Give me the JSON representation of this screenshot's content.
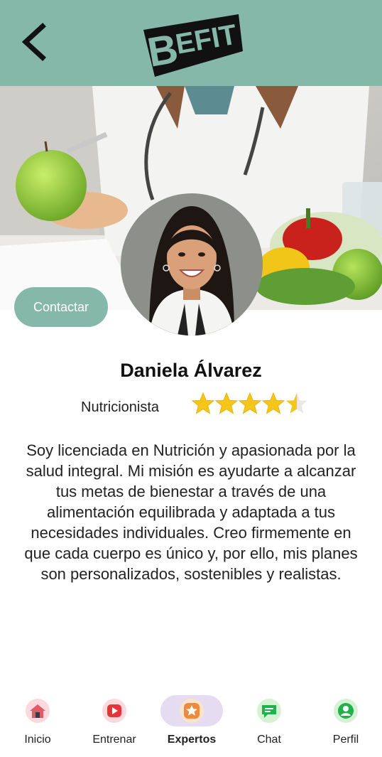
{
  "header": {
    "logo_text": "BEFIT",
    "back_icon": "chevron-left-icon",
    "background": "#86b8aa"
  },
  "profile": {
    "contact_label": "Contactar",
    "name": "Daniela Álvarez",
    "role": "Nutricionista",
    "rating": 4.5,
    "max_rating": 5,
    "bio": "Soy licenciada en Nutrición y apasionada por la salud integral. Mi misión es ayudarte a alcanzar tus metas de bienestar a través de una alimentación equilibrada y adaptada a tus necesidades individuales. Creo firmemente en que cada cuerpo es único y, por ello, mis planes son personalizados, sostenibles y realistas."
  },
  "tabs": [
    {
      "label": "Inicio",
      "icon": "home-icon",
      "active": false
    },
    {
      "label": "Entrenar",
      "icon": "play-icon",
      "active": false
    },
    {
      "label": "Expertos",
      "icon": "star-icon",
      "active": true
    },
    {
      "label": "Chat",
      "icon": "chat-icon",
      "active": false
    },
    {
      "label": "Perfil",
      "icon": "profile-icon",
      "active": false
    }
  ],
  "colors": {
    "accent": "#86b8aa",
    "star": "#f5c518",
    "active_tab_bg": "#e6dcf2"
  }
}
